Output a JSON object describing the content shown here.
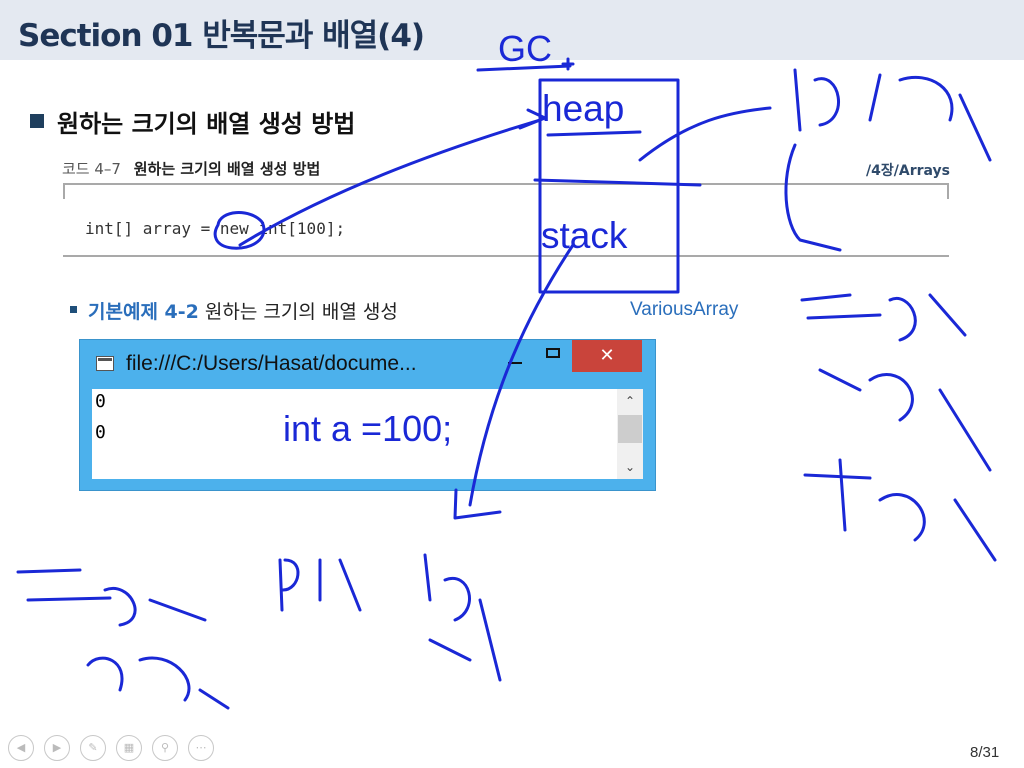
{
  "slide": {
    "title": "Section 01 반복문과 배열(4)",
    "heading": "원하는 크기의 배열 생성 방법",
    "code_caption": {
      "number": "코드 4–7",
      "title": "원하는 크기의 배열 생성 방법",
      "path": "/4장/Arrays"
    },
    "code_line": "int[] array = new int[100];",
    "example": {
      "label": "기본예제 4-2",
      "text": "원하는 크기의 배열 생성",
      "class_name": "VariousArray"
    },
    "page": "8/31"
  },
  "console_window": {
    "title": "file:///C:/Users/Hasat/docume...",
    "close_symbol": "✕",
    "output": [
      "0",
      "0"
    ],
    "scroll_up": "⌃",
    "scroll_down": "⌄"
  },
  "annotations": {
    "gc": "GC",
    "heap": "heap",
    "stack": "stack",
    "statement": "int a =100;",
    "ink_color": "#1a28d6"
  },
  "controls": {
    "icons": [
      "prev-icon",
      "next-icon",
      "pen-icon",
      "slides-icon",
      "zoom-icon",
      "more-icon"
    ]
  },
  "colors": {
    "title_bar": "#e4e9f1",
    "title_text": "#1f3556",
    "accent_blue": "#2a6ebb",
    "window_frame": "#4cb1ec",
    "close_button": "#c9443b"
  }
}
